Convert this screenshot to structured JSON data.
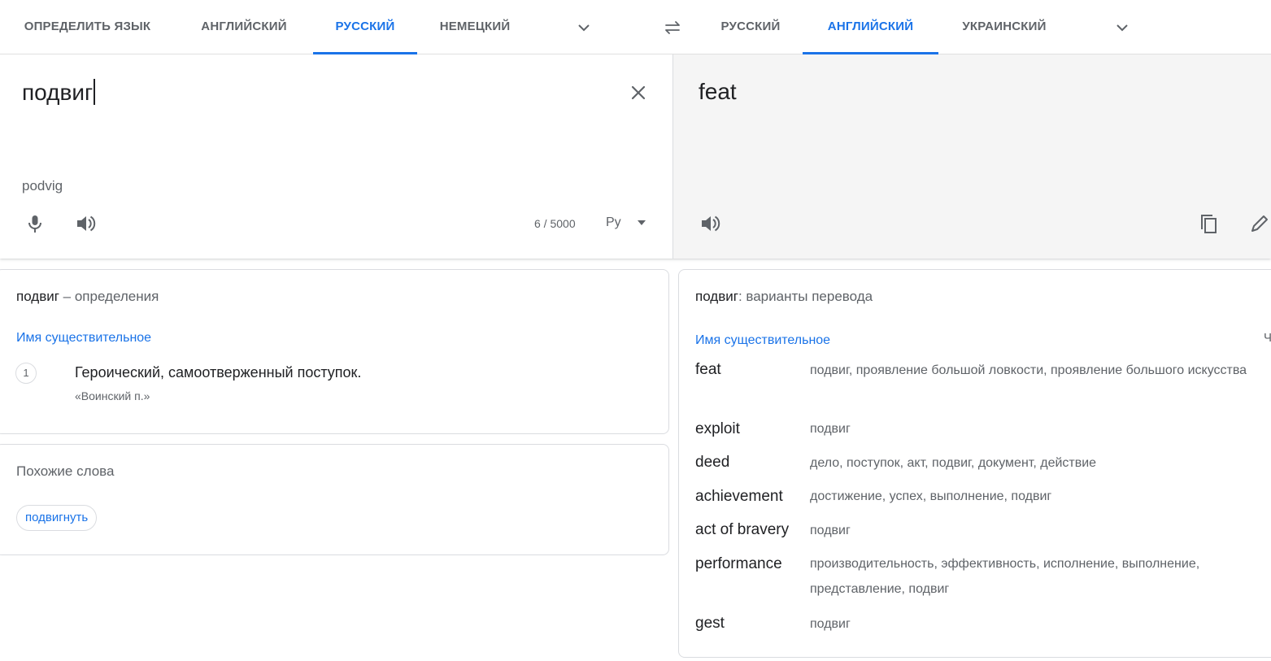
{
  "source_tabs": [
    "ОПРЕДЕЛИТЬ ЯЗЫК",
    "АНГЛИЙСКИЙ",
    "РУССКИЙ",
    "НЕМЕЦКИЙ"
  ],
  "target_tabs": [
    "РУССКИЙ",
    "АНГЛИЙСКИЙ",
    "УКРАИНСКИЙ"
  ],
  "source": {
    "text": "подвиг",
    "transliteration": "podvig",
    "char_count": "6 / 5000",
    "keyboard": "Ру"
  },
  "target": {
    "text": "feat"
  },
  "definitions": {
    "word": "подвиг",
    "suffix": " – определения",
    "part_of_speech": "Имя существительное",
    "entries": [
      {
        "num": "1",
        "text": "Героический, самоотверженный поступок.",
        "example": "«Воинский п.»"
      }
    ]
  },
  "similar": {
    "title": "Похожие слова",
    "chips": [
      "подвигнуть"
    ]
  },
  "translations": {
    "word": "подвиг",
    "suffix": ": варианты перевода",
    "part_of_speech": "Имя существительное",
    "edge_letter": "Ч",
    "rows": [
      {
        "word": "feat",
        "synonyms": "подвиг, проявление большой ловкости, проявление большого искусства"
      },
      {
        "word": "exploit",
        "synonyms": "подвиг"
      },
      {
        "word": "deed",
        "synonyms": "дело, поступок, акт, подвиг, документ, действие"
      },
      {
        "word": "achievement",
        "synonyms": "достижение, успех, выполнение, подвиг"
      },
      {
        "word": "act of bravery",
        "synonyms": "подвиг"
      },
      {
        "word": "performance",
        "synonyms": "производительность, эффективность, исполнение, выполнение, представление, подвиг"
      },
      {
        "word": "gest",
        "synonyms": "подвиг"
      }
    ]
  },
  "colors": {
    "accent": "#1a73e8",
    "text": "#202124",
    "muted": "#5f6368",
    "target_bg": "#f5f5f5"
  }
}
